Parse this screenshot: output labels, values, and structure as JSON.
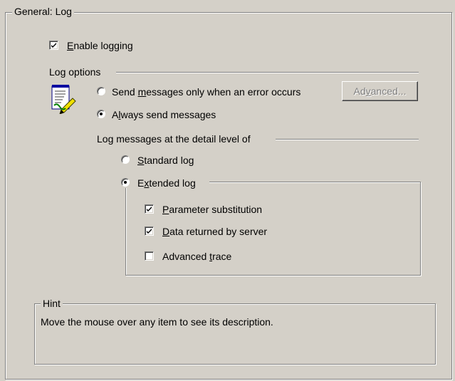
{
  "general_group": {
    "title": "General: Log"
  },
  "enable_logging": {
    "label_u": "E",
    "label_rest": "nable logging",
    "checked": true
  },
  "log_options": {
    "title": "Log options",
    "icon": "notepad-pencil-icon",
    "radio_error": {
      "pre": "Send ",
      "u": "m",
      "post": "essages only when an error occurs",
      "selected": false
    },
    "radio_always": {
      "pre": "A",
      "u": "l",
      "post": "ways send messages",
      "selected": true
    },
    "advanced_button": {
      "pre": "Ad",
      "u": "v",
      "post": "anced...",
      "enabled": false
    }
  },
  "detail_level": {
    "title": "Log messages at the detail level of",
    "radio_standard": {
      "u": "S",
      "post": "tandard log",
      "selected": false
    },
    "radio_extended": {
      "pre": "E",
      "u": "x",
      "post": "tended log",
      "selected": true
    }
  },
  "extended_options": {
    "param_subst": {
      "u": "P",
      "post": "arameter substitution",
      "checked": true
    },
    "data_returned": {
      "u": "D",
      "post": "ata returned by server",
      "checked": true
    },
    "advanced_trace": {
      "pre": "Advanced ",
      "u": "t",
      "post": "race",
      "checked": false
    }
  },
  "hint": {
    "title": "Hint",
    "text": "Move the mouse over any item to see its description."
  }
}
